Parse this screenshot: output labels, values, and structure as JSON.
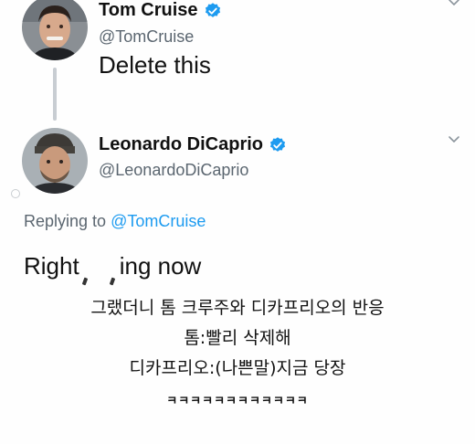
{
  "original_tweet": {
    "author_name": "Tom Cruise",
    "handle": "@TomCruise",
    "text": "Delete this"
  },
  "reply_tweet": {
    "author_name": "Leonardo DiCaprio",
    "handle": "@LeonardoDiCaprio",
    "replying_prefix": "Replying to ",
    "replying_to": "@TomCruise",
    "text_start": "Right",
    "text_end": "ing now"
  },
  "caption": {
    "line1": "그랬더니 톰 크루주와 디카프리오의 반응",
    "line2": "톰:빨리 삭제해",
    "line3": "디카프리오:(나쁜말)지금 당장",
    "line4": "ㅋㅋㅋㅋㅋㅋㅋㅋㅋㅋㅋㅋ"
  },
  "icons": {
    "verified": "verified-badge-icon",
    "menu": "chevron-down-icon"
  },
  "colors": {
    "link": "#1d9bf0",
    "verified": "#1d9bf0",
    "secondary_text": "#5b6670",
    "thread_line": "#c8cdd2"
  }
}
